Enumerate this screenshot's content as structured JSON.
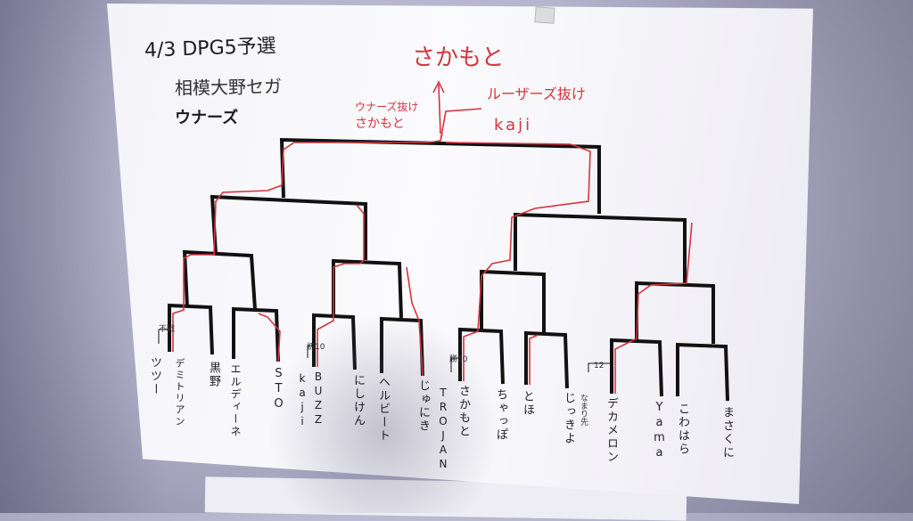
{
  "header": {
    "title": "4/3 DPG5予選",
    "subtitle": "相模大野セガ",
    "section": "ウナーズ"
  },
  "result": {
    "champion": "さかもと",
    "winners_label": "ウナーズ抜け",
    "winners_name": "さかもと",
    "losers_label": "ルーザーズ抜け",
    "losers_name": "kaji"
  },
  "players": [
    "ツツー",
    "デミトリアン",
    "黒野",
    "エルディーネ",
    "STO",
    "BUZZ",
    "kaji",
    "にしけん",
    "ヘルビート",
    "じゅにき",
    "さかもと",
    "TROJAN",
    "ちゃっぽ",
    "とほ",
    "じっきよ",
    "デカメロン",
    "Yama",
    "こわはら",
    "まさくに"
  ],
  "notes": [
    "不戦",
    "初10",
    "勝10",
    "12",
    "なまり先"
  ],
  "colors": {
    "bracket": "#111111",
    "marker_red": "#d5343e",
    "paper": "#f8f8fb"
  }
}
